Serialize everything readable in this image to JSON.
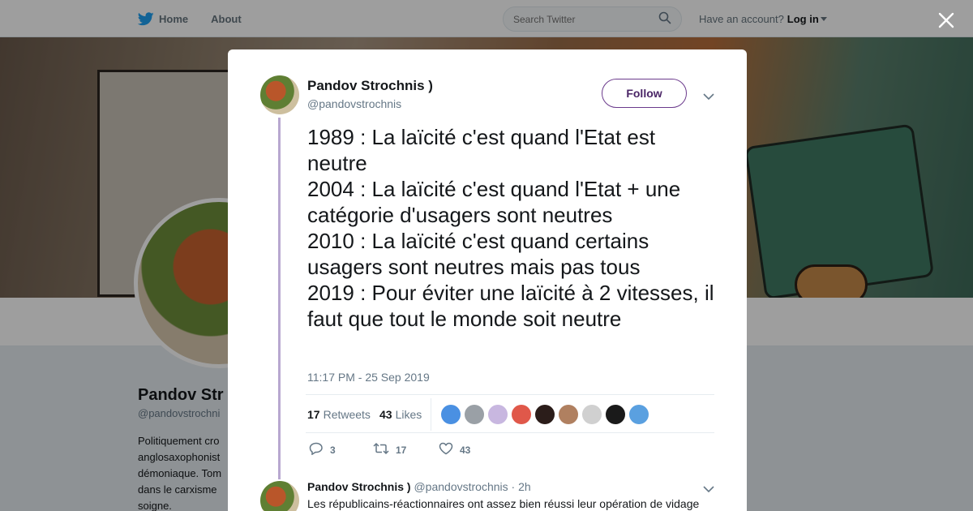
{
  "topbar": {
    "nav": [
      {
        "label": "Home",
        "icon": "twitter-bird-icon"
      },
      {
        "label": "About"
      }
    ],
    "search_placeholder": "Search Twitter",
    "account_prompt": "Have an account?",
    "login_label": "Log in"
  },
  "background_profile": {
    "name": "Pandov Str",
    "handle": "@pandovstrochni",
    "bio_lines": [
      "Politiquement cro",
      "anglosaxophonist",
      "démoniaque. Tom",
      "dans le carxisme",
      "soigne."
    ]
  },
  "tweet": {
    "author_name": "Pandov Strochnis )",
    "author_handle": "@pandovstrochnis",
    "follow_label": "Follow",
    "text_lines": [
      "1989 : La laïcité c'est quand l'Etat est neutre",
      "2004 : La laïcité c'est quand l'Etat + une catégorie d'usagers sont neutres",
      "2010 : La laïcité c'est quand certains usagers sont neutres mais pas tous",
      "2019 : Pour éviter une laïcité à 2 vitesses, il faut que tout le monde soit neutre"
    ],
    "timestamp": "11:17 PM - 25 Sep 2019",
    "retweets_count": "17",
    "retweets_label": "Retweets",
    "likes_count": "43",
    "likes_label": "Likes",
    "liker_avatar_colors": [
      "#4a90e2",
      "#9aa0a6",
      "#c8b7e0",
      "#e0584a",
      "#2b1d1a",
      "#b08060",
      "#d0d0d0",
      "#1a1a1a",
      "#5aa0e0"
    ],
    "actions": {
      "reply_count": "3",
      "retweet_count": "17",
      "like_count": "43"
    }
  },
  "reply": {
    "author_name": "Pandov Strochnis )",
    "author_handle": "@pandovstrochnis",
    "separator": "·",
    "time": "2h",
    "text": "Les républicains-réactionnaires ont assez bien réussi leur opération de vidage"
  },
  "colors": {
    "accent": "#6b3a8c",
    "thread_line": "#b8a8d0",
    "muted_text": "#657786",
    "twitter_blue": "#1da1f2"
  }
}
